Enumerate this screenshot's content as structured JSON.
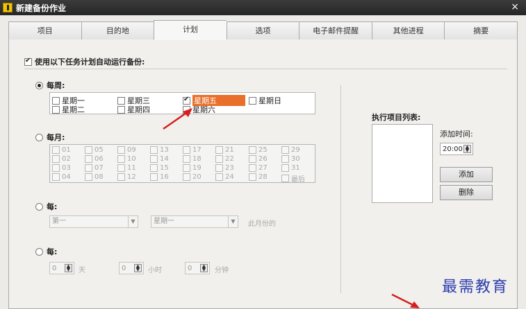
{
  "window": {
    "title": "新建备份作业",
    "close_symbol": "×"
  },
  "tabs": [
    {
      "label": "项目"
    },
    {
      "label": "目的地"
    },
    {
      "label": "计划",
      "active": true
    },
    {
      "label": "选项"
    },
    {
      "label": "电子邮件提醒"
    },
    {
      "label": "其他进程"
    },
    {
      "label": "摘要"
    }
  ],
  "schedule": {
    "enable_label": "使用以下任务计划自动运行备份:",
    "enabled": true
  },
  "weekly": {
    "label": "每周:",
    "selected": true,
    "days": [
      {
        "label": "星期一",
        "checked": false
      },
      {
        "label": "星期三",
        "checked": false
      },
      {
        "label": "星期五",
        "checked": true,
        "highlight": true
      },
      {
        "label": "星期日",
        "checked": false
      },
      {
        "label": "星期二",
        "checked": false
      },
      {
        "label": "星期四",
        "checked": false
      },
      {
        "label": "星期六",
        "checked": false
      }
    ]
  },
  "monthly": {
    "label": "每月:",
    "selected": false,
    "days": [
      "01",
      "05",
      "09",
      "13",
      "17",
      "21",
      "25",
      "29",
      "02",
      "06",
      "10",
      "14",
      "18",
      "22",
      "26",
      "30",
      "03",
      "07",
      "11",
      "15",
      "19",
      "23",
      "27",
      "31",
      "04",
      "08",
      "12",
      "16",
      "20",
      "24",
      "28",
      "最后"
    ]
  },
  "every_nth": {
    "label": "每:",
    "selected": false,
    "ordinal": "第一",
    "weekday": "星期一",
    "suffix": "此月份的"
  },
  "interval": {
    "label": "每:",
    "selected": false,
    "days_value": "0",
    "days_unit": "天",
    "hours_value": "0",
    "hours_unit": "小时",
    "minutes_value": "0",
    "minutes_unit": "分钟"
  },
  "run_list": {
    "label": "执行项目列表:",
    "add_time_label": "添加时间:",
    "time_value": "20:00",
    "add_button": "添加",
    "delete_button": "删除"
  },
  "watermark": "最需教育",
  "colors": {
    "highlight": "#e8702a",
    "watermark": "#2d3cae",
    "arrow": "#d42020"
  }
}
